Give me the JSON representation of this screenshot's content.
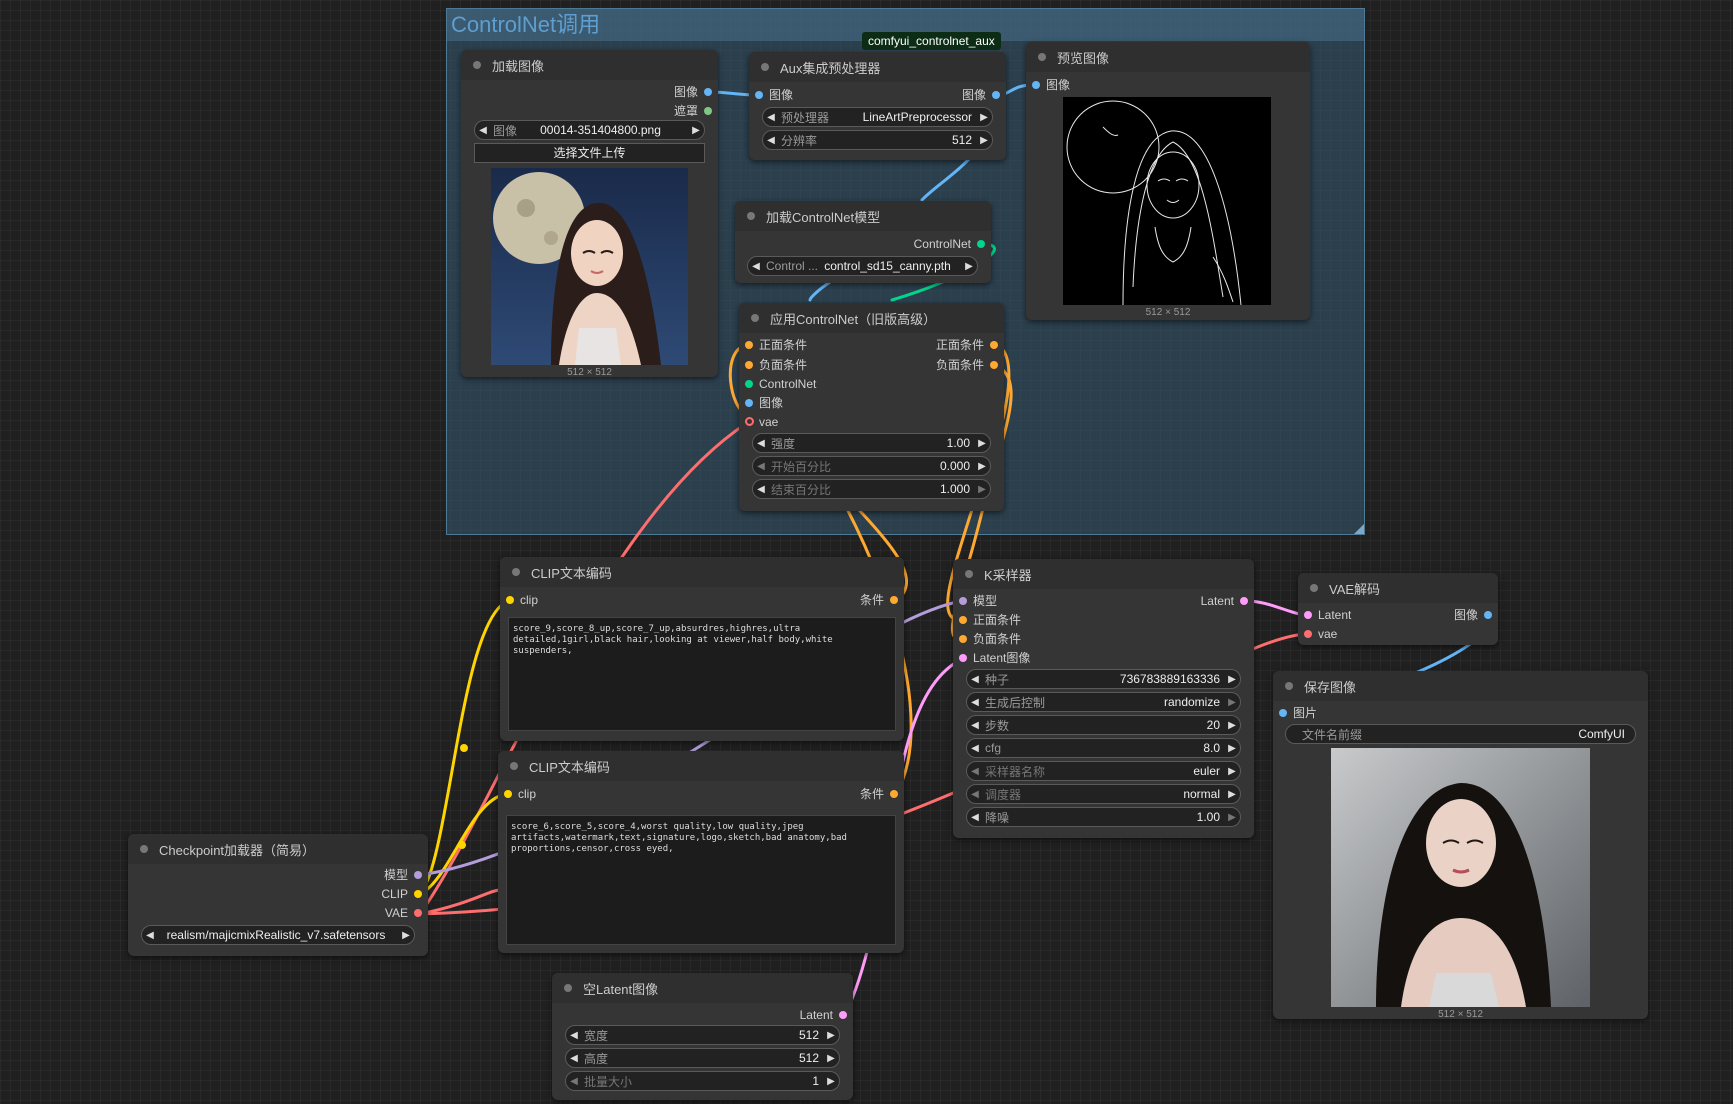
{
  "colors": {
    "socket_image": "#64b5f6",
    "socket_mask": "#81c784",
    "socket_conditioning": "#ffa931",
    "socket_controlnet": "#00d78d",
    "socket_vae": "#ff6e6e",
    "socket_clip": "#ffd500",
    "socket_model": "#b39ddb",
    "socket_latent": "#ff9cf9",
    "group_title": "#5d9fd0",
    "badge_bg": "#0c2c16"
  },
  "group": {
    "title": "ControlNet调用"
  },
  "badge": {
    "text": "comfyui_controlnet_aux"
  },
  "nodes": {
    "load_image": {
      "title": "加载图像",
      "outputs": [
        "图像",
        "遮罩"
      ],
      "image_widget": {
        "label": "图像",
        "value": "00014-351404800.png"
      },
      "upload_button": "选择文件上传",
      "preview_icon": "portrait-woman-moon-photo",
      "size": "512 × 512"
    },
    "aux_preprocessor": {
      "title": "Aux集成预处理器",
      "input": "图像",
      "output": "图像",
      "widgets": [
        {
          "label": "预处理器",
          "value": "LineArtPreprocessor"
        },
        {
          "label": "分辨率",
          "value": "512"
        }
      ]
    },
    "preview_image": {
      "title": "预览图像",
      "input": "图像",
      "preview_icon": "lineart-portrait-image",
      "size": "512 × 512"
    },
    "load_controlnet": {
      "title": "加载ControlNet模型",
      "output": "ControlNet",
      "widget": {
        "label": "Control ...",
        "value": "control_sd15_canny.pth"
      }
    },
    "apply_controlnet": {
      "title": "应用ControlNet（旧版高级）",
      "inputs": [
        "正面条件",
        "负面条件",
        "ControlNet",
        "图像",
        "vae"
      ],
      "outputs": [
        "正面条件",
        "负面条件"
      ],
      "widgets": [
        {
          "label": "强度",
          "value": "1.00"
        },
        {
          "label": "开始百分比",
          "value": "0.000"
        },
        {
          "label": "结束百分比",
          "value": "1.000"
        }
      ]
    },
    "clip_positive": {
      "title": "CLIP文本编码",
      "input": "clip",
      "output": "条件",
      "text": "score_9,score_8_up,score_7_up,absurdres,highres,ultra detailed,1girl,black hair,looking at viewer,half body,white suspenders,"
    },
    "clip_negative": {
      "title": "CLIP文本编码",
      "input": "clip",
      "output": "条件",
      "text": "score_6,score_5,score_4,worst quality,low quality,jpeg artifacts,watermark,text,signature,logo,sketch,bad anatomy,bad proportions,censor,cross eyed,"
    },
    "ksampler": {
      "title": "K采样器",
      "inputs": [
        "模型",
        "正面条件",
        "负面条件",
        "Latent图像"
      ],
      "output": "Latent",
      "widgets": [
        {
          "label": "种子",
          "value": "736783889163336"
        },
        {
          "label": "生成后控制",
          "value": "randomize"
        },
        {
          "label": "步数",
          "value": "20"
        },
        {
          "label": "cfg",
          "value": "8.0"
        },
        {
          "label": "采样器名称",
          "value": "euler"
        },
        {
          "label": "调度器",
          "value": "normal"
        },
        {
          "label": "降噪",
          "value": "1.00"
        }
      ]
    },
    "vae_decode": {
      "title": "VAE解码",
      "inputs": [
        "Latent",
        "vae"
      ],
      "output": "图像"
    },
    "save_image": {
      "title": "保存图像",
      "input": "图片",
      "widget": {
        "label": "文件名前缀",
        "value": "ComfyUI"
      },
      "preview_icon": "portrait-woman-generated-photo",
      "size": "512 × 512"
    },
    "checkpoint_loader": {
      "title": "Checkpoint加载器（简易）",
      "outputs": [
        "模型",
        "CLIP",
        "VAE"
      ],
      "widget": {
        "value": "realism/majicmixRealistic_v7.safetensors"
      }
    },
    "empty_latent": {
      "title": "空Latent图像",
      "output": "Latent",
      "widgets": [
        {
          "label": "宽度",
          "value": "512"
        },
        {
          "label": "高度",
          "value": "512"
        },
        {
          "label": "批量大小",
          "value": "1"
        }
      ]
    }
  }
}
